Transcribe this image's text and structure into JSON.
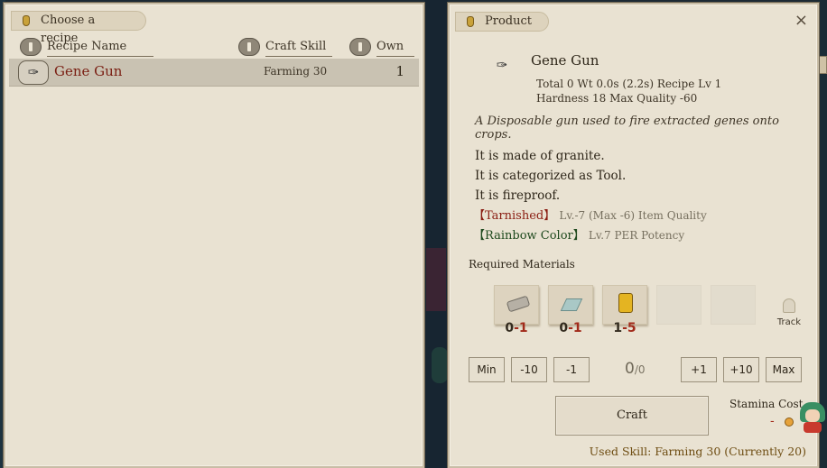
{
  "left_panel": {
    "title": "Choose a recipe",
    "columns": {
      "name": "Recipe Name",
      "skill": "Craft Skill",
      "own": "Own"
    },
    "recipes": [
      {
        "name": "Gene Gun",
        "skill": "Farming 30",
        "own": "1"
      }
    ]
  },
  "right_panel": {
    "title": "Product",
    "close": "×",
    "product": {
      "name": "Gene Gun",
      "stats_line1": "Total 0  Wt 0.0s (2.2s)  Recipe Lv 1",
      "stats_line2": "Hardness 18  Max Quality -60",
      "description": "A Disposable gun used to fire extracted genes onto crops.",
      "facts": [
        "It is made of granite.",
        "It is categorized as Tool.",
        "It is fireproof."
      ],
      "enchants": [
        {
          "name": "【Tarnished】",
          "detail": "Lv.-7 (Max -6) Item Quality",
          "color": "#8a1d12"
        },
        {
          "name": "【Rainbow Color】",
          "detail": "Lv.7 PER Potency",
          "color": "#1f4a1e"
        }
      ]
    },
    "required_label": "Required Materials",
    "materials": [
      {
        "icon": "log-material-icon",
        "have": "0",
        "need": "-1"
      },
      {
        "icon": "gem-material-icon",
        "have": "0",
        "need": "-1"
      },
      {
        "icon": "jar-material-icon",
        "have": "1",
        "need": "-5"
      }
    ],
    "track_label": "Track",
    "quantity": {
      "min_label": "Min",
      "minus10_label": "-10",
      "minus1_label": "-1",
      "value": "0",
      "max_value": "/0",
      "plus1_label": "+1",
      "plus10_label": "+10",
      "max_label": "Max"
    },
    "craft_label": "Craft",
    "stamina_label": "Stamina Cost",
    "stamina_value": "-",
    "used_skill": "Used Skill: Farming 30 (Currently 20)"
  }
}
